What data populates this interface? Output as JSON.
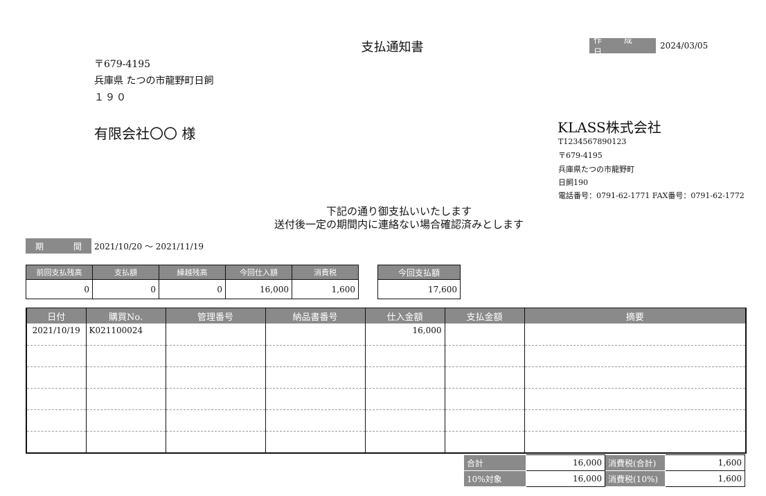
{
  "document": {
    "title": "支払通知書",
    "created_label": "作 成 日",
    "created_date": "2024/03/05"
  },
  "recipient": {
    "postal": "〒679-4195",
    "address1": "兵庫県 たつの市龍野町日飼",
    "address2": "１９０",
    "name": "有限会社〇〇 様"
  },
  "issuer": {
    "company": "KLASS株式会社",
    "reg_no": "T1234567890123",
    "postal": "〒679-4195",
    "address1": "兵庫県たつの市龍野町",
    "address2": "日飼190",
    "contact": "電話番号：0791-62-1771 FAX番号：0791-62-1772"
  },
  "notice": {
    "line1": "下記の通り御支払いいたします",
    "line2": "送付後一定の期間内に連絡ない場合確認済みとします"
  },
  "period": {
    "label_a": "期",
    "label_b": "間",
    "value": "2021/10/20 ～ 2021/11/19"
  },
  "summary": {
    "headers": [
      "前回支払残高",
      "支払額",
      "繰越残高",
      "今回仕入額",
      "消費税"
    ],
    "values": [
      "0",
      "0",
      "0",
      "16,000",
      "1,600"
    ]
  },
  "payment": {
    "header": "今回支払額",
    "value": "17,600"
  },
  "detail": {
    "headers": [
      "日付",
      "購買No.",
      "管理番号",
      "納品書番号",
      "仕入金額",
      "支払金額",
      "摘要"
    ],
    "rows": [
      [
        "2021/10/19",
        "K021100024",
        "",
        "",
        "16,000",
        "",
        ""
      ],
      [
        "",
        "",
        "",
        "",
        "",
        "",
        ""
      ],
      [
        "",
        "",
        "",
        "",
        "",
        "",
        ""
      ],
      [
        "",
        "",
        "",
        "",
        "",
        "",
        ""
      ],
      [
        "",
        "",
        "",
        "",
        "",
        "",
        ""
      ],
      [
        "",
        "",
        "",
        "",
        "",
        "",
        ""
      ]
    ]
  },
  "totals": {
    "total_label": "合計",
    "total_value": "16,000",
    "tax_total_label": "消費税(合計)",
    "tax_total_value": "1,600",
    "rate_label": "10%対象",
    "rate_value": "16,000",
    "tax_rate_label": "消費税(10%)",
    "tax_rate_value": "1,600"
  }
}
